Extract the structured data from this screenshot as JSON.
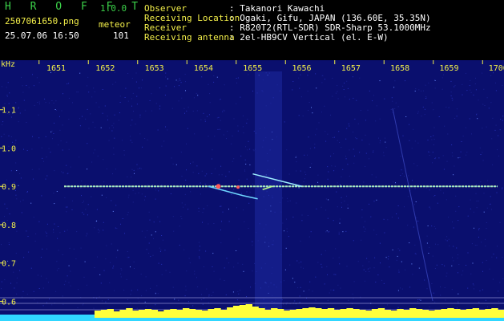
{
  "header": {
    "app_name": "H R O F F T",
    "version": "1.0.0",
    "file_name": "2507061650.png",
    "mode": "meteor",
    "datetime": "25.07.06 16:50",
    "count": "101",
    "info": [
      {
        "label": "Observer",
        "value": ": Takanori Kawachi"
      },
      {
        "label": "Receiving Location",
        "value": ": Ogaki, Gifu, JAPAN (136.60E, 35.35N)"
      },
      {
        "label": "Receiver",
        "value": ": R820T2(RTL-SDR) SDR-Sharp 53.1000MHz"
      },
      {
        "label": "Receiving antenna",
        "value": ": 2el-HB9CV Vertical (el. E-W)"
      }
    ]
  },
  "colors": {
    "background": "#000000",
    "plot_background": "#0a0f6e",
    "header_green": "#3cd24a",
    "tick_yellow": "#f4f04a",
    "signal_line": "#dfff9a",
    "meteor": "#ff5a5a",
    "power_bar": "#ffff3a",
    "power_base": "#30d7ff"
  },
  "chart_data": {
    "type": "heatmap",
    "y_unit_label": "kHz",
    "x_ticks": [
      "1651",
      "1652",
      "1653",
      "1654",
      "1655",
      "1656",
      "1657",
      "1658",
      "1659",
      "1700"
    ],
    "y_ticks": [
      "1.1",
      "1.0",
      "0.9",
      "0.8",
      "0.7",
      "0.6"
    ],
    "ylim": [
      0.58,
      1.2
    ],
    "xlim": [
      1650.5,
      1700.1
    ],
    "carrier_khz": 0.9,
    "meteor_echo": {
      "start": 1654.3,
      "end": 1656.2,
      "peak_khz": 0.92,
      "low_khz": 0.88
    },
    "power_trace": [
      0.2,
      0.2,
      0.2,
      0.2,
      0.2,
      0.2,
      0.2,
      0.2,
      0.2,
      0.2,
      0.2,
      0.2,
      0.2,
      0.2,
      0.2,
      0.45,
      0.5,
      0.55,
      0.4,
      0.5,
      0.6,
      0.45,
      0.5,
      0.55,
      0.5,
      0.4,
      0.5,
      0.55,
      0.5,
      0.6,
      0.55,
      0.5,
      0.45,
      0.55,
      0.6,
      0.5,
      0.65,
      0.75,
      0.8,
      0.85,
      0.7,
      0.6,
      0.5,
      0.6,
      0.55,
      0.45,
      0.5,
      0.55,
      0.6,
      0.65,
      0.6,
      0.55,
      0.6,
      0.5,
      0.55,
      0.6,
      0.55,
      0.5,
      0.45,
      0.55,
      0.6,
      0.5,
      0.45,
      0.55,
      0.5,
      0.6,
      0.55,
      0.5,
      0.45,
      0.5,
      0.55,
      0.6,
      0.55,
      0.5,
      0.55,
      0.6,
      0.5,
      0.55,
      0.6,
      0.5
    ]
  }
}
